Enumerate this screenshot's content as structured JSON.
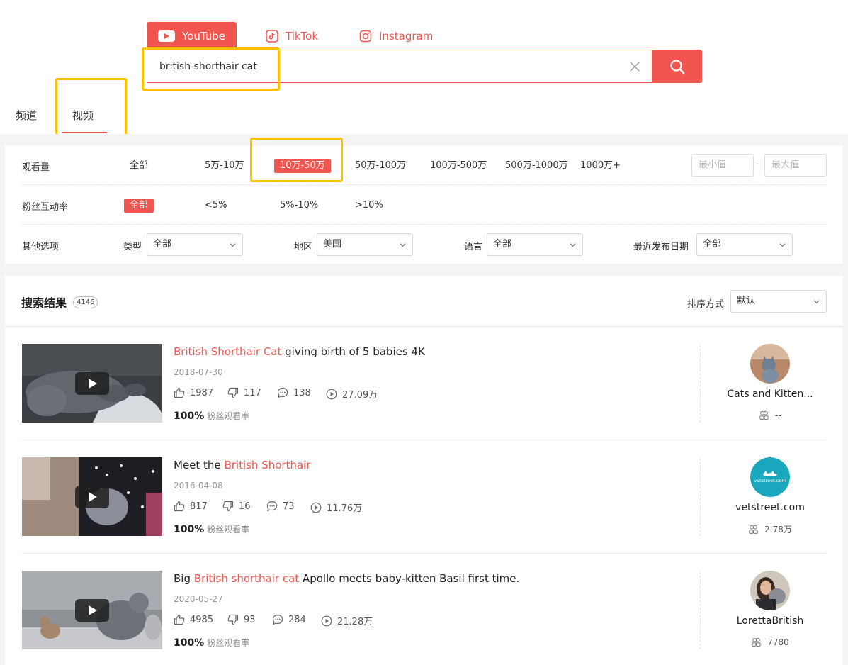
{
  "platforms": [
    {
      "label": "YouTube",
      "active": true
    },
    {
      "label": "TikTok",
      "active": false
    },
    {
      "label": "Instagram",
      "active": false
    }
  ],
  "search": {
    "value": "british shorthair cat"
  },
  "content_tabs": [
    {
      "label": "频道",
      "active": false
    },
    {
      "label": "视频",
      "active": true
    }
  ],
  "filters": {
    "views": {
      "label": "观看量",
      "options": [
        "全部",
        "5万-10万",
        "10万-50万",
        "50万-100万",
        "100万-500万",
        "500万-1000万",
        "1000万+"
      ],
      "selected": "10万-50万",
      "min_placeholder": "最小值",
      "max_placeholder": "最大值",
      "range_sep": "-"
    },
    "engagement": {
      "label": "粉丝互动率",
      "options": [
        "全部",
        "<5%",
        "5%-10%",
        ">10%"
      ],
      "selected": "全部"
    },
    "other": {
      "label": "其他选项",
      "selects": [
        {
          "label": "类型",
          "value": "全部"
        },
        {
          "label": "地区",
          "value": "美国"
        },
        {
          "label": "语言",
          "value": "全部"
        },
        {
          "label": "最近发布日期",
          "value": "全部"
        }
      ]
    }
  },
  "results": {
    "title": "搜索结果",
    "count": "4146",
    "sort_label": "排序方式",
    "sort_value": "默认",
    "items": [
      {
        "title_highlight": "British Shorthair Cat",
        "title_rest": " giving birth of 5 babies 4K",
        "title_pre": "",
        "date": "2018-07-30",
        "likes": "1987",
        "dislikes": "117",
        "comments": "138",
        "views": "27.09万",
        "rate_value": "100%",
        "rate_label": "粉丝观看率",
        "channel_name": "Cats and Kitten...",
        "channel_subs": "--"
      },
      {
        "title_pre": "Meet the ",
        "title_highlight": "British Shorthair",
        "title_rest": "",
        "date": "2016-04-08",
        "likes": "817",
        "dislikes": "16",
        "comments": "73",
        "views": "11.76万",
        "rate_value": "100%",
        "rate_label": "粉丝观看率",
        "channel_name": "vetstreet.com",
        "channel_subs": "2.78万"
      },
      {
        "title_pre": "Big ",
        "title_highlight": "British shorthair cat",
        "title_rest": " Apollo meets baby-kitten Basil first time.",
        "date": "2020-05-27",
        "likes": "4985",
        "dislikes": "93",
        "comments": "284",
        "views": "21.28万",
        "rate_value": "100%",
        "rate_label": "粉丝观看率",
        "channel_name": "LorettaBritish",
        "channel_subs": "7780"
      }
    ]
  },
  "logo_text": {
    "vetstreet": "vetstreet.com"
  },
  "colors": {
    "accent": "#f0554f",
    "highlight_box": "#ffc000"
  },
  "icons": [
    "youtube-icon",
    "tiktok-icon",
    "instagram-icon",
    "clear-icon",
    "search-icon",
    "chevron-down-icon",
    "thumbs-up-icon",
    "thumbs-down-icon",
    "comment-icon",
    "play-circle-icon",
    "subscribers-icon",
    "play-icon"
  ]
}
